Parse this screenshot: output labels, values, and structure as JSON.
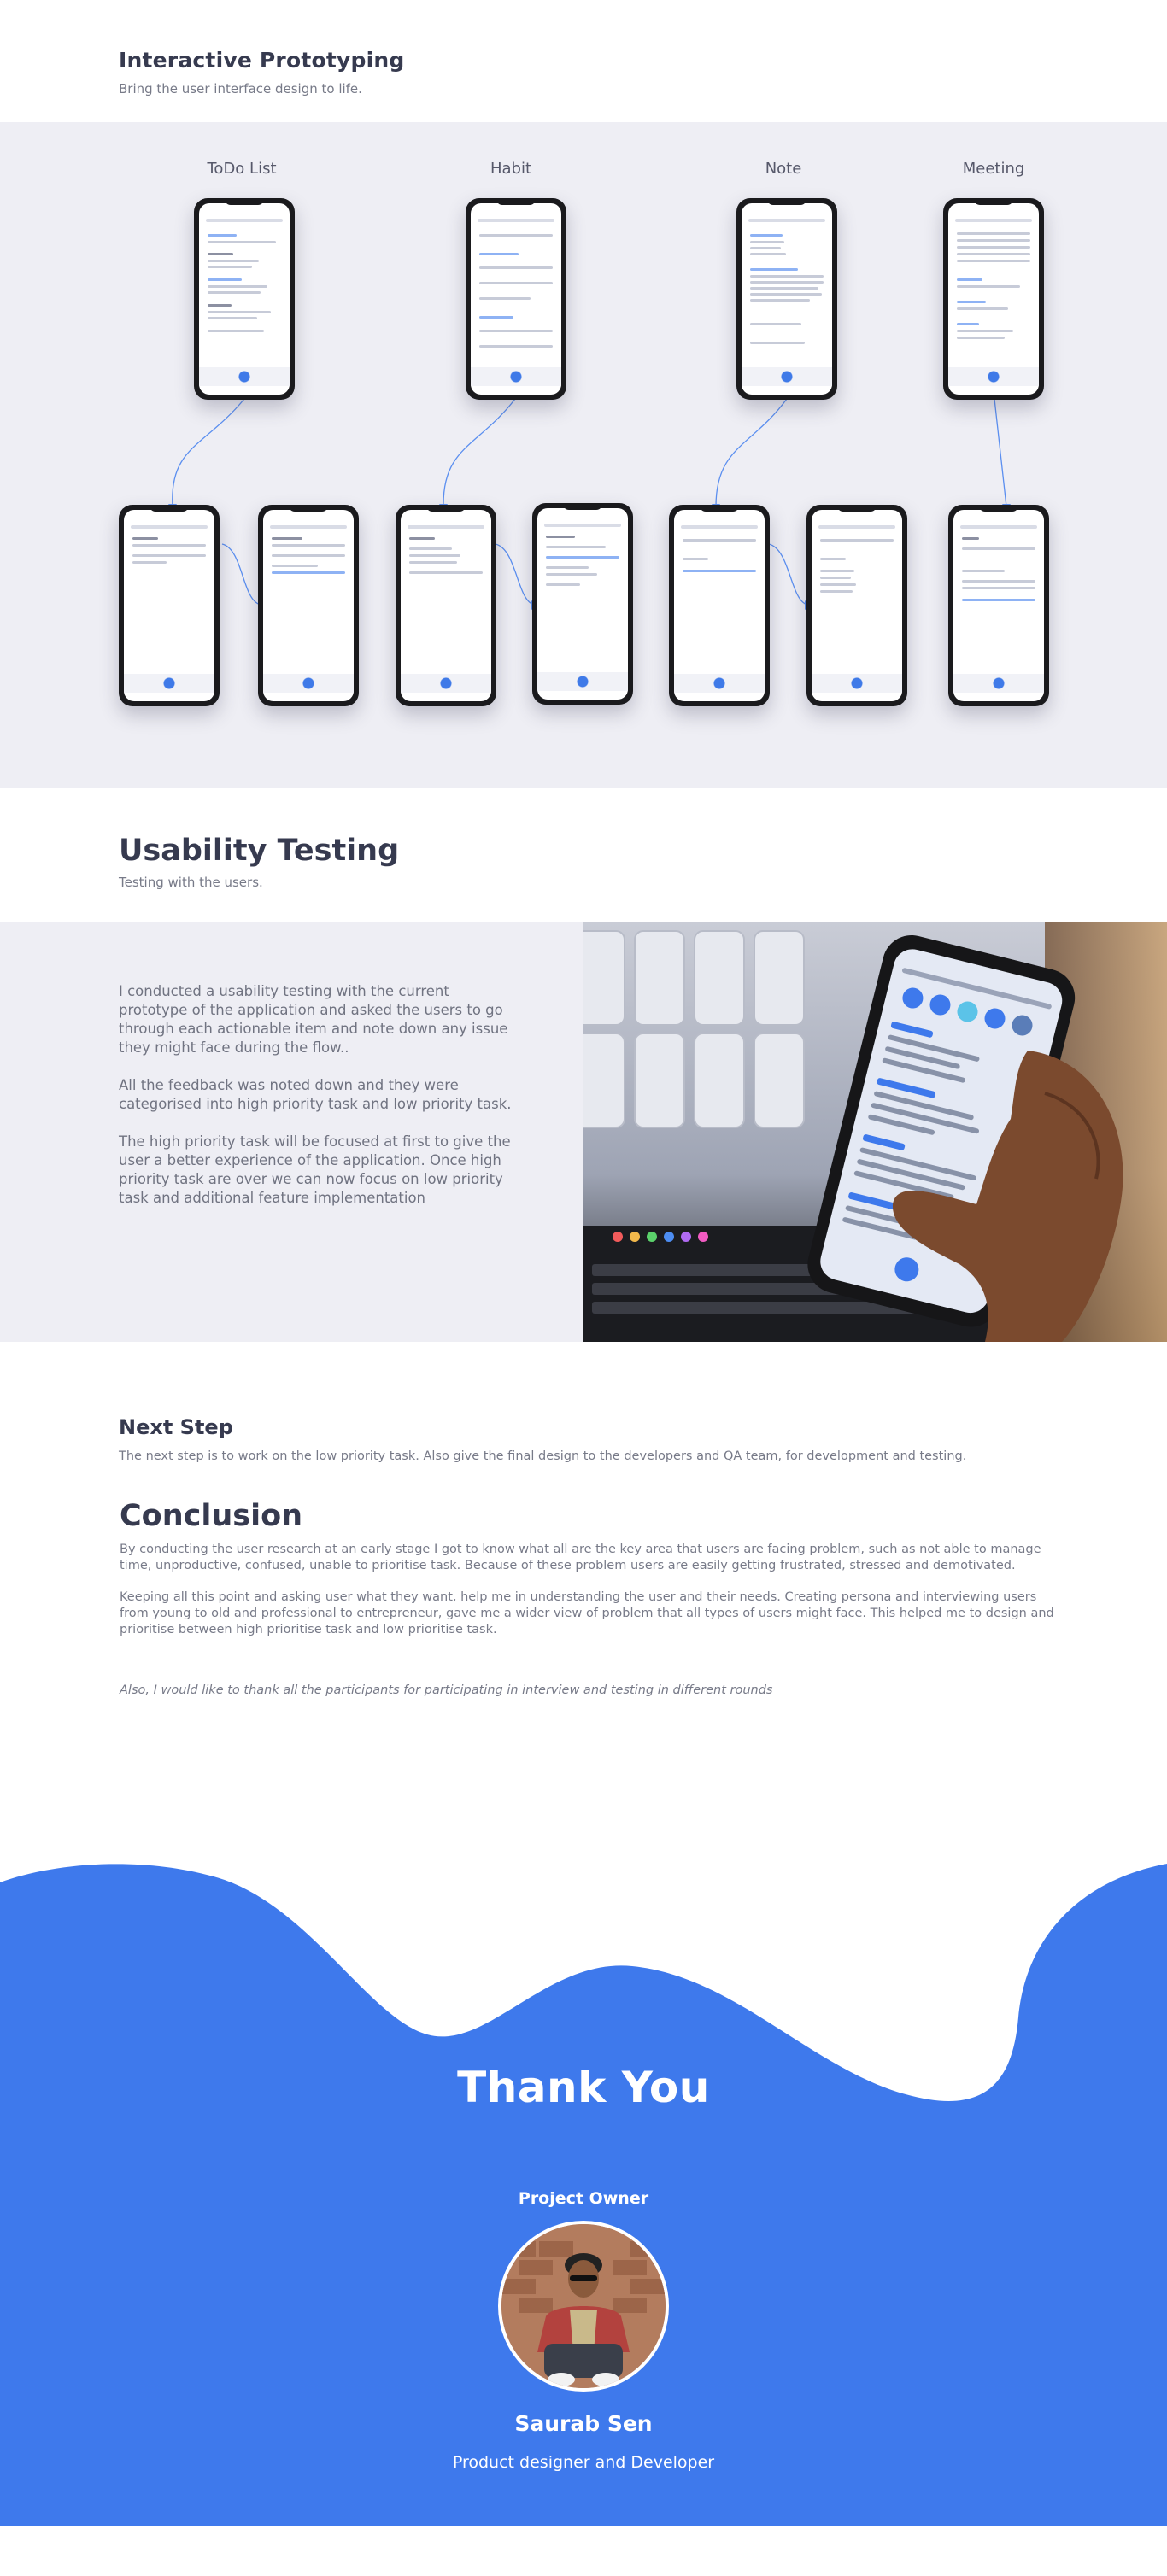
{
  "prototyping": {
    "title": "Interactive Prototyping",
    "subtitle": "Bring the user interface design to life.",
    "columns": [
      "ToDo List",
      "Habit",
      "Note",
      "Meeting"
    ]
  },
  "usability": {
    "title": "Usability Testing",
    "subtitle": "Testing with the users.",
    "paragraphs": [
      "I conducted a usability testing with the current prototype of the application and asked the users to go through each actionable item and note down any issue they might face during the flow..",
      "All the feedback was noted down and they were categorised into high priority task and low priority task.",
      "The high priority task will be focused at first to give the user a better experience of the application. Once high priority task are over we can now focus on low priority task and additional feature implementation"
    ]
  },
  "next_step": {
    "title": "Next Step",
    "text": "The next step is to work on the low priority task. Also give the final design to the developers and QA team, for development and testing."
  },
  "conclusion": {
    "title": "Conclusion",
    "paragraphs": [
      "By conducting the user research at an early stage I got to know what all are the key area that users are facing problem, such as not able to manage time, unproductive, confused, unable to prioritise task. Because of these problem users are easily getting frustrated, stressed and demotivated.",
      "Keeping all this point and asking user what they want, help me in understanding the user and their needs. Creating persona and interviewing users from young to old and professional to entrepreneur, gave me a wider view of problem that all types of users might face. This helped me to design and prioritise between high prioritise task and low prioritise task."
    ],
    "thanks": "Also, I would like to thank all the participants for participating in interview and testing in different rounds"
  },
  "footer": {
    "heading": "Thank You",
    "role": "Project Owner",
    "name": "Saurab Sen",
    "title": "Product designer and Developer",
    "accent": "#3e79ec"
  }
}
